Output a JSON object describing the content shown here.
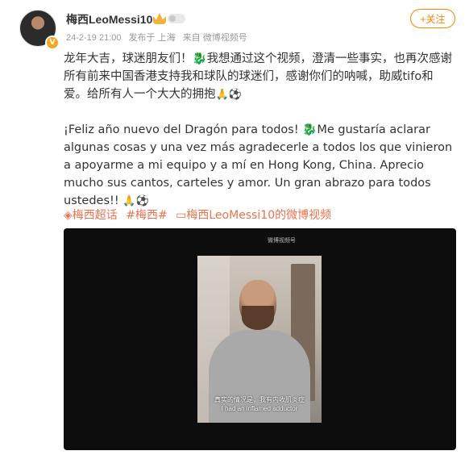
{
  "author": {
    "name": "梅西LeoMessi10",
    "date": "24-2-19 21:00",
    "location": "发布于 上海",
    "source": "来自 微博视频号"
  },
  "follow_label": "+关注",
  "paragraph1": {
    "line1": "龙年大吉，球迷朋友们！",
    "emoji_dragon": "🐉",
    "line2": "我想通过这个视频，澄清一些事实，也再次感谢所有前来中国香港支持我和球队的球迷们，感谢你们的呐喊，助威tifo和爱。给所有人一个大大的拥抱",
    "emoji_end": "🙏⚽"
  },
  "paragraph2": {
    "part1": "¡Feliz año nuevo del Dragón para todos!",
    "emoji_dragon": "🐉",
    "part2": "Me gustaría aclarar algunas cosas y una vez más agradecerle a todos los que vinieron a apoyarme a mi equipo y a mí en Hong Kong, China. Aprecio mucho sus cantos, carteles y amor. Un gran abrazo para todos ustedes!!",
    "emoji_end": "🙏⚽"
  },
  "tags": [
    "◈梅西超话",
    "#梅西#",
    "▭梅西LeoMessi10的微博视频"
  ],
  "video": {
    "watermark": "微博视频号",
    "subtitle_zh": "真实的情况是，我有内收肌炎症",
    "subtitle_en": "I had an inflamed adductor"
  }
}
